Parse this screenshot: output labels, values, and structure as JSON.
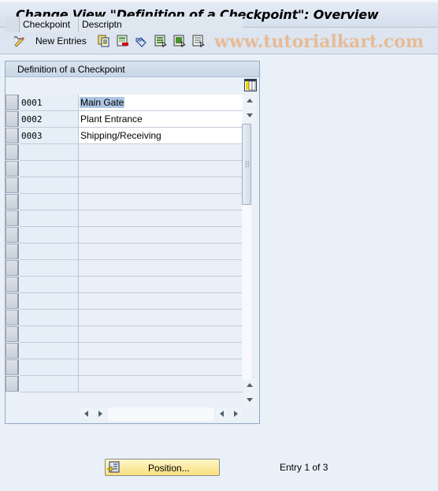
{
  "window": {
    "title": "Change View \"Definition of a Checkpoint\": Overview"
  },
  "toolbar": {
    "items": [
      {
        "icon": "edit-pencil-icon",
        "label": ""
      },
      {
        "icon": "",
        "label": "New Entries"
      },
      {
        "icon": "copy-as-icon",
        "label": ""
      },
      {
        "icon": "delete-icon",
        "label": ""
      },
      {
        "icon": "undo-change-icon",
        "label": ""
      },
      {
        "icon": "select-all-icon",
        "label": ""
      },
      {
        "icon": "select-block-icon",
        "label": ""
      },
      {
        "icon": "deselect-all-icon",
        "label": ""
      }
    ],
    "new_entries_label": "New Entries"
  },
  "watermark": "www.tutorialkart.com",
  "table": {
    "title": "Definition of a Checkpoint",
    "columns": [
      "Checkpoint",
      "Descriptn"
    ],
    "rows": [
      {
        "checkpoint": "0001",
        "description": "Main Gate",
        "selected_text": true
      },
      {
        "checkpoint": "0002",
        "description": "Plant Entrance",
        "selected_text": false
      },
      {
        "checkpoint": "0003",
        "description": "Shipping/Receiving",
        "selected_text": false
      }
    ],
    "empty_rows": 15
  },
  "footer": {
    "position_button_label": "Position...",
    "entry_info": "Entry 1 of 3"
  },
  "colors": {
    "background": "#e9f0f8",
    "highlight": "#aec6e3",
    "position_button": "#f8df7e",
    "watermark": "#e9b488"
  }
}
